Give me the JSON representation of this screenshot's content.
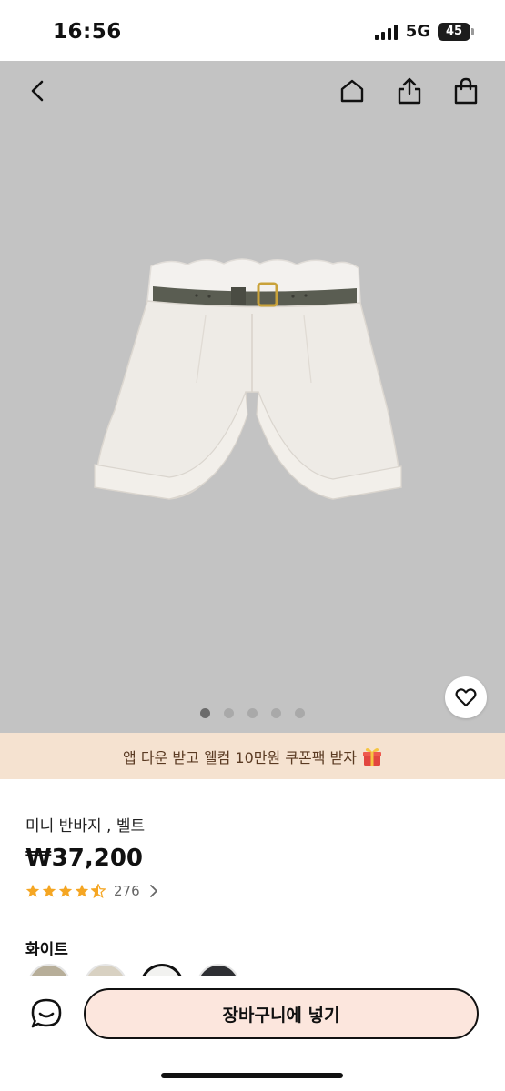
{
  "status_bar": {
    "time": "16:56",
    "network": "5G",
    "battery": "45"
  },
  "top_nav": {
    "icons": [
      "back-icon",
      "home-icon",
      "share-icon",
      "shopping-bag-icon"
    ]
  },
  "gallery": {
    "image_count": 5,
    "active_index": 0
  },
  "banner": {
    "text": "앱 다운 받고 웰컴 10만원 쿠폰팩 받자",
    "icon": "gift-icon"
  },
  "product": {
    "title": "미니 반바지 , 벨트",
    "price": "₩37,200",
    "rating_stars": 4.5,
    "review_count": "276"
  },
  "options": {
    "label": "화이트",
    "swatches": [
      {
        "color": "#b7ae99"
      },
      {
        "color": "#d8d1c2"
      },
      {
        "color": "#f2f2f0",
        "selected": true
      },
      {
        "color": "#2e2f33"
      }
    ]
  },
  "bottom_bar": {
    "cart_label": "장바구니에 넣기"
  },
  "colors": {
    "gallery_bg": "#c3c3c3",
    "banner_bg": "#f5e2d0",
    "star": "#f5a623",
    "cart_bg": "#fce6dd"
  }
}
